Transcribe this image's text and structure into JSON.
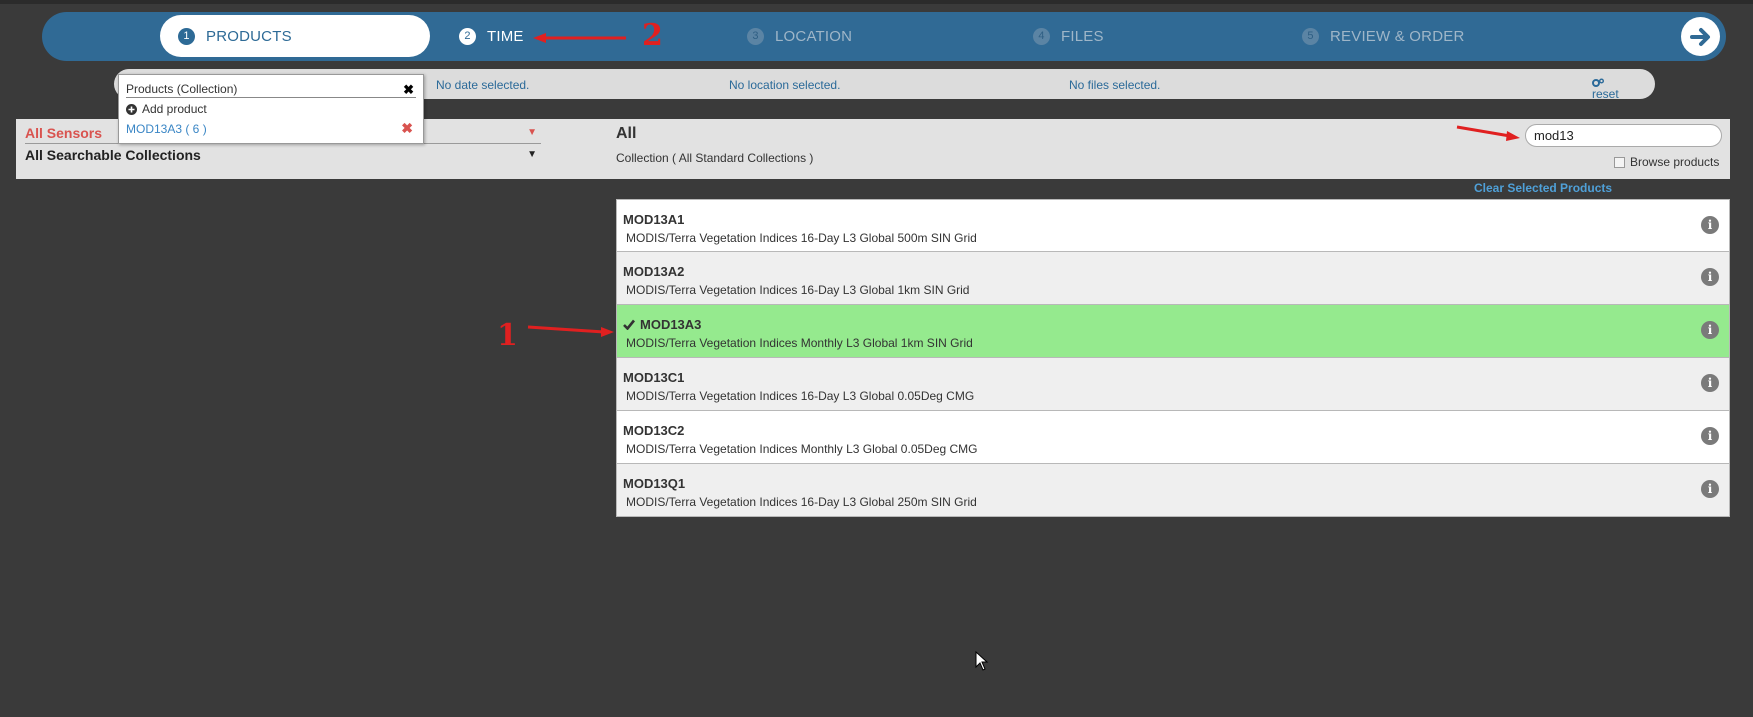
{
  "wizard": {
    "steps": [
      {
        "num": "1",
        "label": "PRODUCTS"
      },
      {
        "num": "2",
        "label": "TIME"
      },
      {
        "num": "3",
        "label": "LOCATION"
      },
      {
        "num": "4",
        "label": "FILES"
      },
      {
        "num": "5",
        "label": "REVIEW & ORDER"
      }
    ],
    "active_step": "PRODUCTS",
    "current_step": "TIME"
  },
  "summary": {
    "date": "No date selected.",
    "location": "No location selected.",
    "files": "No files selected.",
    "reset": "reset"
  },
  "popup": {
    "header": "Products (Collection)",
    "add_product": "Add product",
    "selected_item": "MOD13A3 ( 6 )"
  },
  "filter": {
    "sensors": "All Sensors",
    "collections": "All Searchable Collections",
    "title": "All",
    "subtitle": "Collection ( All Standard Collections )",
    "search_value": "mod13",
    "browse_products": "Browse products"
  },
  "clear_selected": "Clear Selected Products",
  "products": [
    {
      "name": "MOD13A1",
      "desc": "MODIS/Terra Vegetation Indices 16-Day L3 Global 500m SIN Grid",
      "selected": false
    },
    {
      "name": "MOD13A2",
      "desc": "MODIS/Terra Vegetation Indices 16-Day L3 Global 1km SIN Grid",
      "selected": false
    },
    {
      "name": "MOD13A3",
      "desc": "MODIS/Terra Vegetation Indices Monthly L3 Global 1km SIN Grid",
      "selected": true
    },
    {
      "name": "MOD13C1",
      "desc": "MODIS/Terra Vegetation Indices 16-Day L3 Global 0.05Deg CMG",
      "selected": false
    },
    {
      "name": "MOD13C2",
      "desc": "MODIS/Terra Vegetation Indices Monthly L3 Global 0.05Deg CMG",
      "selected": false
    },
    {
      "name": "MOD13Q1",
      "desc": "MODIS/Terra Vegetation Indices 16-Day L3 Global 250m SIN Grid",
      "selected": false
    }
  ],
  "annotations": {
    "label_1": "1",
    "label_2": "2"
  },
  "colors": {
    "wizard_bg": "#306a95",
    "selected_row": "#95ea8e",
    "annotation": "#e02020"
  }
}
